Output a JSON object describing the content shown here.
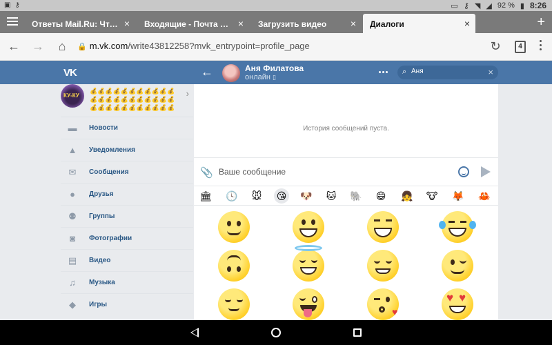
{
  "status_bar": {
    "battery": "92 %",
    "time": "8:26"
  },
  "browser": {
    "tabs": [
      {
        "label": "Ответы Mail.Ru: Что де",
        "active": false
      },
      {
        "label": "Входящие - Почта Mail.",
        "active": false
      },
      {
        "label": "Загрузить видео",
        "active": false
      },
      {
        "label": "Диалоги",
        "active": true
      }
    ],
    "close_glyph": "×",
    "new_tab_glyph": "+",
    "url_host": "m.vk.com",
    "url_path": "/write43812258?mvk_entrypoint=profile_page",
    "tab_count": "4"
  },
  "vk_header": {
    "logo": "VK",
    "contact_name": "Аня Филатова",
    "contact_status": "онлайн",
    "search_value": "Аня"
  },
  "sidebar": {
    "profile_avatar_label": "КУ-КУ",
    "items": [
      {
        "label": "Новости",
        "icon": "news-icon"
      },
      {
        "label": "Уведомления",
        "icon": "bell-icon"
      },
      {
        "label": "Сообщения",
        "icon": "messages-icon"
      },
      {
        "label": "Друзья",
        "icon": "friends-icon"
      },
      {
        "label": "Группы",
        "icon": "groups-icon"
      },
      {
        "label": "Фотографии",
        "icon": "camera-icon"
      },
      {
        "label": "Видео",
        "icon": "video-icon"
      },
      {
        "label": "Музыка",
        "icon": "music-icon"
      },
      {
        "label": "Игры",
        "icon": "gamepad-icon"
      }
    ]
  },
  "chat": {
    "empty_history": "История сообщений пуста.",
    "message_placeholder": "Ваше сообщение"
  },
  "sticker_tabs": [
    {
      "icon": "store-icon",
      "active": false
    },
    {
      "icon": "recent-clock-icon",
      "active": false
    },
    {
      "icon": "sticker-pack-1-icon",
      "active": false
    },
    {
      "icon": "emoji-smiley-icon",
      "active": true
    },
    {
      "icon": "sticker-pack-2-icon",
      "active": false
    },
    {
      "icon": "sticker-pack-3-icon",
      "active": false
    },
    {
      "icon": "sticker-pack-4-icon",
      "active": false
    },
    {
      "icon": "sticker-pack-5-icon",
      "active": false
    },
    {
      "icon": "sticker-pack-6-icon",
      "active": false
    },
    {
      "icon": "sticker-pack-7-icon",
      "active": false
    },
    {
      "icon": "sticker-pack-8-icon",
      "active": false
    },
    {
      "icon": "sticker-pack-9-icon",
      "active": false
    }
  ],
  "emojis": [
    "slightly-smiling",
    "grinning",
    "laughing",
    "tears-of-joy",
    "upside-down",
    "smiling-halo",
    "relieved-grin",
    "winking",
    "pensive-smile",
    "winking-tongue",
    "kissing-heart",
    "heart-eyes"
  ]
}
